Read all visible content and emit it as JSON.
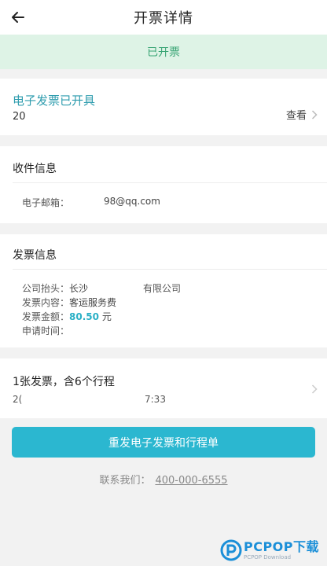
{
  "header": {
    "title": "开票详情"
  },
  "status": {
    "text": "已开票"
  },
  "invoice": {
    "title": "电子发票已开具",
    "number": "20",
    "view_label": "查看"
  },
  "receive": {
    "title": "收件信息",
    "email_label": "电子邮箱：",
    "email_value": "98@qq.com"
  },
  "billing": {
    "title": "发票信息",
    "company_label": "公司抬头：",
    "company_prefix": "长沙",
    "company_suffix": "有限公司",
    "content_label": "发票内容：",
    "content_value": "客运服务费",
    "amount_label": "发票金额：",
    "amount_value": "80.50",
    "amount_unit": "元",
    "time_label": "申请时间：",
    "time_value": ""
  },
  "trips": {
    "summary": "1张发票，含6个行程",
    "time_start": "2(",
    "time_end": "7:33"
  },
  "actions": {
    "resend_label": "重发电子发票和行程单"
  },
  "contact": {
    "label": "联系我们：",
    "phone": "400-000-6555"
  },
  "watermark": {
    "brand": "PCPOP下载",
    "sub": "PCPOP Download"
  },
  "colors": {
    "accent": "#2bb7d0",
    "success": "#38a474",
    "success_bg": "#def3e6",
    "link": "#2e9cae"
  }
}
